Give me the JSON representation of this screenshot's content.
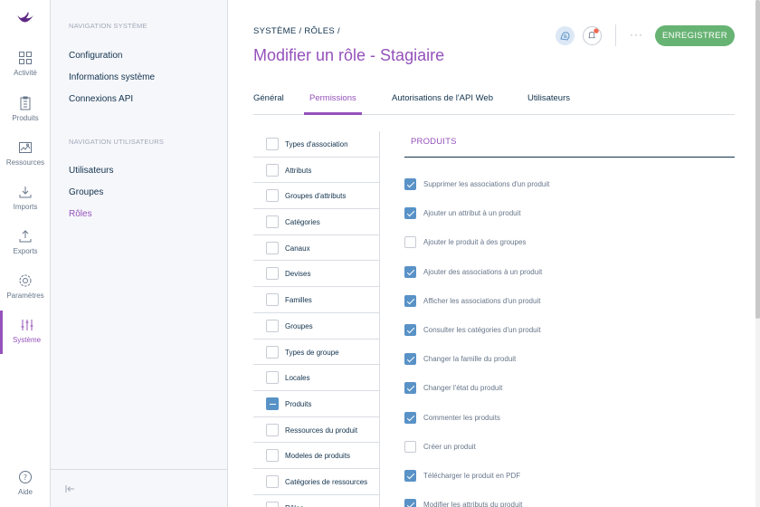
{
  "rail": {
    "items": [
      {
        "label": "Activité",
        "icon": "dashboard-icon"
      },
      {
        "label": "Produits",
        "icon": "products-icon"
      },
      {
        "label": "Ressources",
        "icon": "assets-icon"
      },
      {
        "label": "Imports",
        "icon": "import-icon"
      },
      {
        "label": "Exports",
        "icon": "export-icon"
      },
      {
        "label": "Paramètres",
        "icon": "settings-icon"
      },
      {
        "label": "Système",
        "icon": "system-icon",
        "active": true
      }
    ],
    "help_label": "Aide"
  },
  "subnav": {
    "system_section": "NAVIGATION SYSTÈME",
    "system_links": [
      "Configuration",
      "Informations système",
      "Connexions API"
    ],
    "users_section": "NAVIGATION UTILISATEURS",
    "users_links": [
      "Utilisateurs",
      "Groupes",
      "Rôles"
    ],
    "active_link": "Rôles"
  },
  "header": {
    "breadcrumb": [
      "SYSTÈME",
      "RÔLES"
    ],
    "title": "Modifier un rôle - Stagiaire",
    "save_label": "ENREGISTRER",
    "more_label": "···"
  },
  "tabs": [
    {
      "label": "Général",
      "active": false
    },
    {
      "label": "Permissions",
      "active": true
    },
    {
      "label": "Autorisations de l'API Web",
      "active": false
    },
    {
      "label": "Utilisateurs",
      "active": false
    }
  ],
  "groups": [
    {
      "label": "Types d'association",
      "state": "off"
    },
    {
      "label": "Attributs",
      "state": "off"
    },
    {
      "label": "Groupes d'attributs",
      "state": "off"
    },
    {
      "label": "Catégories",
      "state": "off"
    },
    {
      "label": "Canaux",
      "state": "off"
    },
    {
      "label": "Devises",
      "state": "off"
    },
    {
      "label": "Familles",
      "state": "off"
    },
    {
      "label": "Groupes",
      "state": "off"
    },
    {
      "label": "Types de groupe",
      "state": "off"
    },
    {
      "label": "Locales",
      "state": "off"
    },
    {
      "label": "Produits",
      "state": "partial"
    },
    {
      "label": "Ressources du produit",
      "state": "off"
    },
    {
      "label": "Modeles de produits",
      "state": "off"
    },
    {
      "label": "Catégories de ressources",
      "state": "off"
    },
    {
      "label": "Rôles",
      "state": "off"
    }
  ],
  "permissions": {
    "section_title": "PRODUITS",
    "items": [
      {
        "label": "Supprimer les associations d'un produit",
        "checked": true
      },
      {
        "label": "Ajouter un attribut à un produit",
        "checked": true
      },
      {
        "label": "Ajouter le produit à des groupes",
        "checked": false
      },
      {
        "label": "Ajouter des associations à un produit",
        "checked": true
      },
      {
        "label": "Afficher les associations d'un produit",
        "checked": true
      },
      {
        "label": "Consulter les catégories d'un produit",
        "checked": true
      },
      {
        "label": "Changer la famille du produit",
        "checked": true
      },
      {
        "label": "Changer l'état du produit",
        "checked": true
      },
      {
        "label": "Commenter les produits",
        "checked": true
      },
      {
        "label": "Créer un produit",
        "checked": false
      },
      {
        "label": "Télécharger le produit en PDF",
        "checked": true
      },
      {
        "label": "Modifier les attributs du produit",
        "checked": true
      }
    ]
  },
  "colors": {
    "brand": "#9452ba",
    "save": "#67b373",
    "checkbox": "#5992c7",
    "notification_dot": "#f0664f"
  }
}
